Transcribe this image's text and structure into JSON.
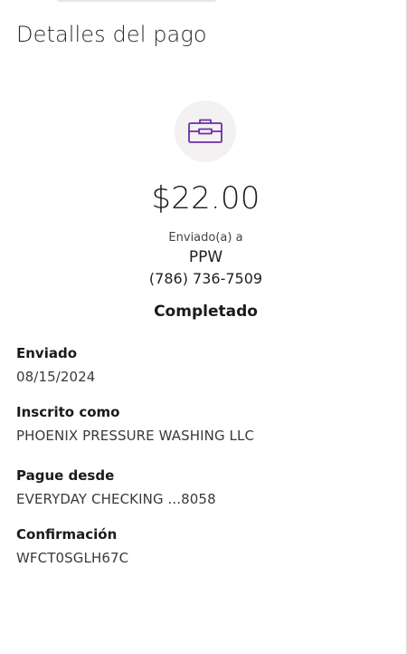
{
  "header": {
    "title": "Detalles del pago"
  },
  "payment": {
    "icon": "briefcase-icon",
    "icon_color": "#6b2fa8",
    "amount": "$22.00",
    "sent_to_label": "Enviado(a) a",
    "recipient_name": "PPW",
    "recipient_phone": "(786) 736-7509",
    "status": "Completado"
  },
  "details": [
    {
      "label": "Enviado",
      "value": "08/15/2024"
    },
    {
      "label": "Inscrito como",
      "value": "PHOENIX PRESSURE WASHING LLC"
    },
    {
      "label": "Pague desde",
      "value": "EVERYDAY CHECKING ...8058"
    },
    {
      "label": "Confirmación",
      "value": "WFCT0SGLH67C"
    }
  ]
}
